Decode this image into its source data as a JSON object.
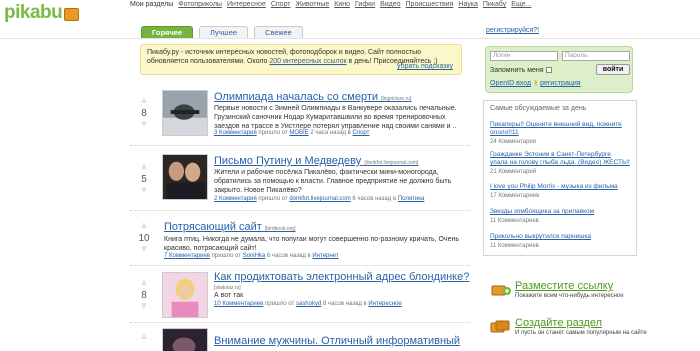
{
  "logo": "pikabu",
  "topnav": {
    "label": "Мои разделы",
    "items": [
      "Фотоприколы",
      "Интересное",
      "Спорт",
      "Животные",
      "Кино",
      "Гифки",
      "Видео",
      "Происшествия",
      "Наука",
      "Пикабу",
      "Еще..."
    ]
  },
  "tabs": [
    "Горячее",
    "Лучшее",
    "Свежее"
  ],
  "register_link": "регистрируйся?!",
  "notice": {
    "text": "Пикабу.ру - источник интересных новостей, фотоподборок и видео. Сайт полностью обновляется пользователями. Около ",
    "link": "200 интересных ссылок",
    "text2": " в день! Присоединяйтесь ;)",
    "hide": "убрать подсказку"
  },
  "login": {
    "login_placeholder": "Логин",
    "password_placeholder": "Пароль",
    "remember": "Запомнить меня",
    "button": "войти",
    "openid": "OpenID вход",
    "register": "регистрация"
  },
  "posts": [
    {
      "votes": "8",
      "title": "Олимпиада началась со смерти",
      "domain": "[bigpicture.ru]",
      "desc": "Первые новости с Зимней Олимпиады в Ванкувере оказались печальные. Грузинский саночник Нодар Кумаритавшвили во время тренировочных заездов на трассе в Уистлере потерял управление над своими санями и ..",
      "comments": "3 Комментария",
      "meta1": "пришло от",
      "author": "MOBIE",
      "meta2": "2 часа назад в",
      "category": "Спорт"
    },
    {
      "votes": "5",
      "title": "Письмо Путину и Медведеву",
      "domain": "[donkfot.livejournal.com]",
      "desc": "Жители и рабочие посёлка Пикалёво, фактически мини-моногорода, обратились за помощью к власти. Главное предприятие не должно быть закрыто. Новое Пикалёво?",
      "comments": "2 Комментария",
      "meta1": "пришло от",
      "author": "donkfot.livejournal.com",
      "meta2": "6 часов назад в",
      "category": "Политика"
    },
    {
      "votes": "10",
      "title": "Потрясающий сайт",
      "domain": "[birdbook.org]",
      "desc": "Книга птиц. Никогда не думала, что попугаи могут совершенно по-разному кричать, Очень красиво, потрясающий сайт!",
      "comments": "7 Комментариев",
      "meta1": "пришло от",
      "author": "SoniHka",
      "meta2": "6 часов назад в",
      "category": "Интернет"
    },
    {
      "votes": "8",
      "title": "Как продиктовать электронный адрес блондинке?",
      "domain": "[skalolaz.ru]",
      "desc": "А вот так",
      "comments": "10 Комментариев",
      "meta1": "пришло от",
      "author": "sashokyd",
      "meta2": "8 часов назад в",
      "category": "Интересное"
    },
    {
      "votes": "",
      "title": "Внимание мужчины. Отличный информативный",
      "domain": "",
      "desc": "",
      "comments": "",
      "meta1": "",
      "author": "",
      "meta2": "",
      "category": ""
    }
  ],
  "discussed": {
    "heading": "Самые обсуждаемые за день",
    "items": [
      {
        "title": "Пикаперы!! Оцените внешний вид, пожните ололо!!11",
        "count": "24 Комментария"
      },
      {
        "title": "Гражданке Эстонии в Санкт-Петербурге упала на голову глыба льда. (Видео) ЖЕСТЬ!!",
        "count": "21 Комментарий"
      },
      {
        "title": "I love you Philip Morris - музыка из фильма",
        "count": "17 Комментариев"
      },
      {
        "title": "Звезды зомбоящика за прилавком",
        "count": "11 Комментариев"
      },
      {
        "title": "Прикольно выкрутился парнишка",
        "count": "11 Комментариев"
      }
    ]
  },
  "actions": [
    {
      "title": "Разместите ссылку",
      "desc": "Покажите всем что-нибудь интересное"
    },
    {
      "title": "Создайте раздел",
      "desc": "И пусть он станет самым популярным на сайте"
    }
  ]
}
